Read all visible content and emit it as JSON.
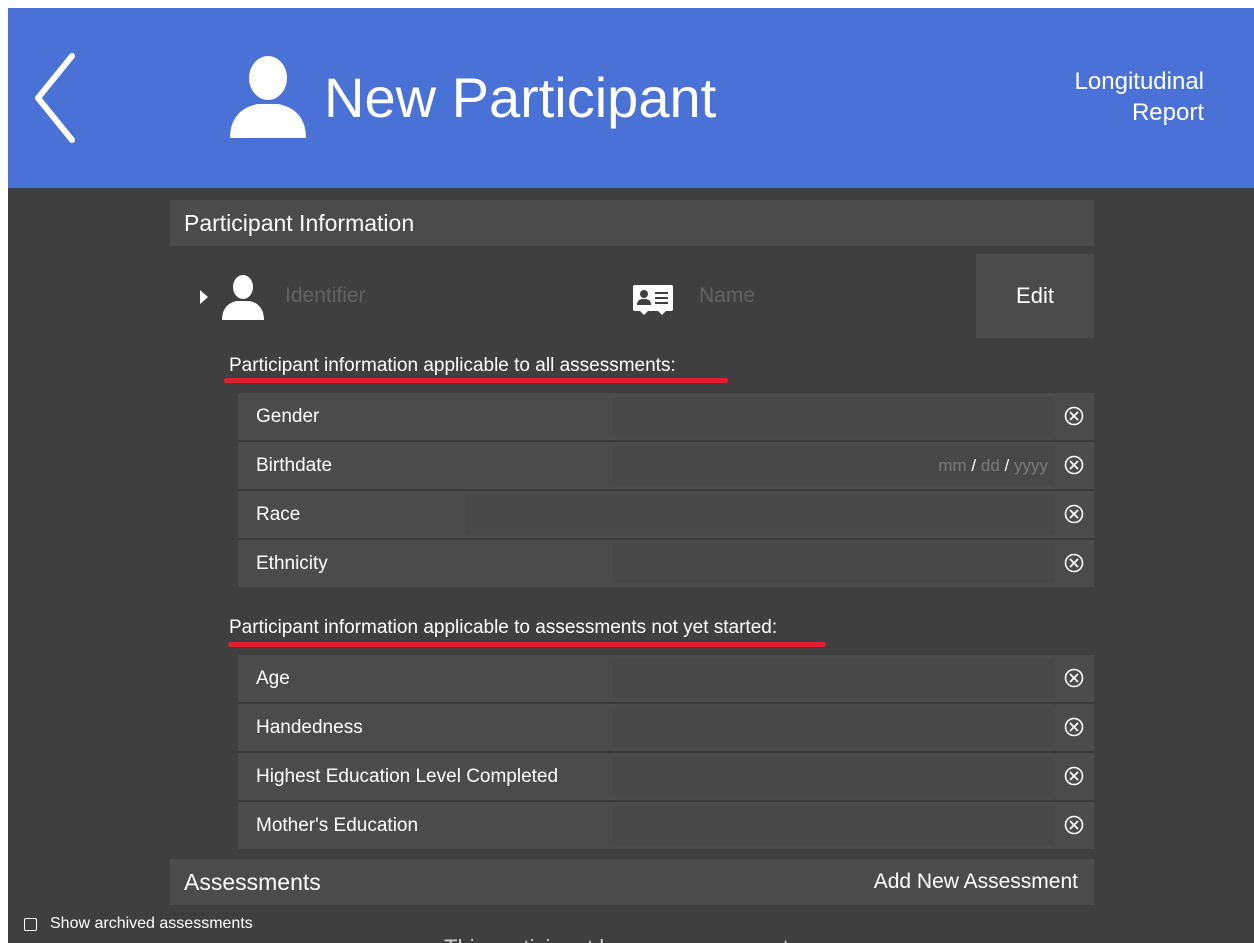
{
  "header": {
    "title": "New Participant",
    "report_link_line1": "Longitudinal",
    "report_link_line2": "Report",
    "background_color": "#4a72d6"
  },
  "participant_section": {
    "title": "Participant Information",
    "identifier_placeholder": "Identifier",
    "name_placeholder": "Name",
    "edit_label": "Edit"
  },
  "all_assessments": {
    "subtitle": "Participant information applicable to all assessments:",
    "fields": [
      {
        "label": "Gender",
        "value": ""
      },
      {
        "label": "Birthdate",
        "date_mm": "mm",
        "date_dd": "dd",
        "date_yyyy": "yyyy",
        "date_sep": "/"
      },
      {
        "label": "Race",
        "value": ""
      },
      {
        "label": "Ethnicity",
        "value": ""
      }
    ]
  },
  "not_started": {
    "subtitle": "Participant information applicable to assessments not yet started:",
    "fields": [
      {
        "label": "Age",
        "value": ""
      },
      {
        "label": "Handedness",
        "value": ""
      },
      {
        "label": "Highest Education Level Completed",
        "value": ""
      },
      {
        "label": "Mother's Education",
        "value": ""
      }
    ]
  },
  "assessments_section": {
    "title": "Assessments",
    "add_label": "Add New Assessment"
  },
  "footer": {
    "show_archived_label": "Show archived assessments",
    "show_archived_checked": false,
    "cut_off_text": "This participant has no assessments"
  },
  "colors": {
    "accent_underline": "#e0202a",
    "panel": "#4b4b4b",
    "background": "#3f3f3f"
  },
  "icons": {
    "back": "chevron-left-icon",
    "title": "person-icon",
    "identifier": "person-icon",
    "name": "id-card-icon",
    "clear": "clear-circle-x-icon",
    "disclosure": "triangle-right-icon"
  }
}
